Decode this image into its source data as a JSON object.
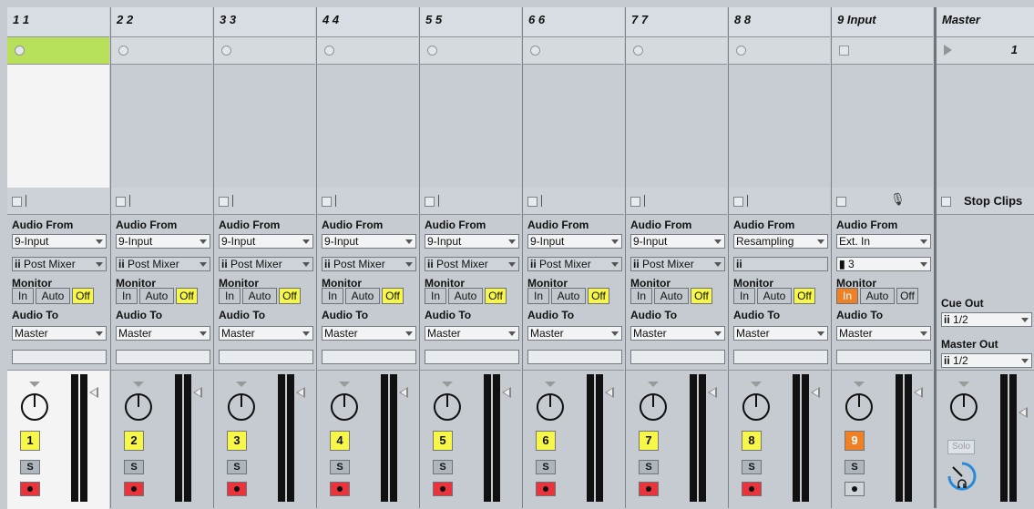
{
  "tracks": [
    {
      "name": "1 1",
      "number": "1",
      "audio_from_label": "Audio From",
      "audio_from": "9-Input",
      "channel": "Post Mixer",
      "monitor_label": "Monitor",
      "mon_in": "In",
      "mon_auto": "Auto",
      "mon_off": "Off",
      "monitor_active": "Off",
      "audio_to_label": "Audio To",
      "audio_to": "Master",
      "solo": "S"
    },
    {
      "name": "2 2",
      "number": "2",
      "audio_from_label": "Audio From",
      "audio_from": "9-Input",
      "channel": "Post Mixer",
      "monitor_label": "Monitor",
      "mon_in": "In",
      "mon_auto": "Auto",
      "mon_off": "Off",
      "monitor_active": "Off",
      "audio_to_label": "Audio To",
      "audio_to": "Master",
      "solo": "S"
    },
    {
      "name": "3 3",
      "number": "3",
      "audio_from_label": "Audio From",
      "audio_from": "9-Input",
      "channel": "Post Mixer",
      "monitor_label": "Monitor",
      "mon_in": "In",
      "mon_auto": "Auto",
      "mon_off": "Off",
      "monitor_active": "Off",
      "audio_to_label": "Audio To",
      "audio_to": "Master",
      "solo": "S"
    },
    {
      "name": "4 4",
      "number": "4",
      "audio_from_label": "Audio From",
      "audio_from": "9-Input",
      "channel": "Post Mixer",
      "monitor_label": "Monitor",
      "mon_in": "In",
      "mon_auto": "Auto",
      "mon_off": "Off",
      "monitor_active": "Off",
      "audio_to_label": "Audio To",
      "audio_to": "Master",
      "solo": "S"
    },
    {
      "name": "5 5",
      "number": "5",
      "audio_from_label": "Audio From",
      "audio_from": "9-Input",
      "channel": "Post Mixer",
      "monitor_label": "Monitor",
      "mon_in": "In",
      "mon_auto": "Auto",
      "mon_off": "Off",
      "monitor_active": "Off",
      "audio_to_label": "Audio To",
      "audio_to": "Master",
      "solo": "S"
    },
    {
      "name": "6 6",
      "number": "6",
      "audio_from_label": "Audio From",
      "audio_from": "9-Input",
      "channel": "Post Mixer",
      "monitor_label": "Monitor",
      "mon_in": "In",
      "mon_auto": "Auto",
      "mon_off": "Off",
      "monitor_active": "Off",
      "audio_to_label": "Audio To",
      "audio_to": "Master",
      "solo": "S"
    },
    {
      "name": "7 7",
      "number": "7",
      "audio_from_label": "Audio From",
      "audio_from": "9-Input",
      "channel": "Post Mixer",
      "monitor_label": "Monitor",
      "mon_in": "In",
      "mon_auto": "Auto",
      "mon_off": "Off",
      "monitor_active": "Off",
      "audio_to_label": "Audio To",
      "audio_to": "Master",
      "solo": "S"
    },
    {
      "name": "8 8",
      "number": "8",
      "audio_from_label": "Audio From",
      "audio_from": "Resampling",
      "channel": "",
      "monitor_label": "Monitor",
      "mon_in": "In",
      "mon_auto": "Auto",
      "mon_off": "Off",
      "monitor_active": "Off",
      "audio_to_label": "Audio To",
      "audio_to": "Master",
      "solo": "S"
    },
    {
      "name": "9 Input",
      "number": "9",
      "audio_from_label": "Audio From",
      "audio_from": "Ext. In",
      "channel": "3",
      "monitor_label": "Monitor",
      "mon_in": "In",
      "mon_auto": "Auto",
      "mon_off": "Off",
      "monitor_active": "In",
      "audio_to_label": "Audio To",
      "audio_to": "Master",
      "solo": "S"
    }
  ],
  "master": {
    "name": "Master",
    "scene_number": "1",
    "stop_clips": "Stop Clips",
    "cue_out_label": "Cue Out",
    "cue_out": "1/2",
    "master_out_label": "Master Out",
    "master_out": "1/2",
    "solo": "Solo"
  },
  "colors": {
    "track_number": "#f7f74a",
    "armed_track_number": "#f08026",
    "selected_slot": "#b8e05a",
    "arm": "#e8343a"
  }
}
